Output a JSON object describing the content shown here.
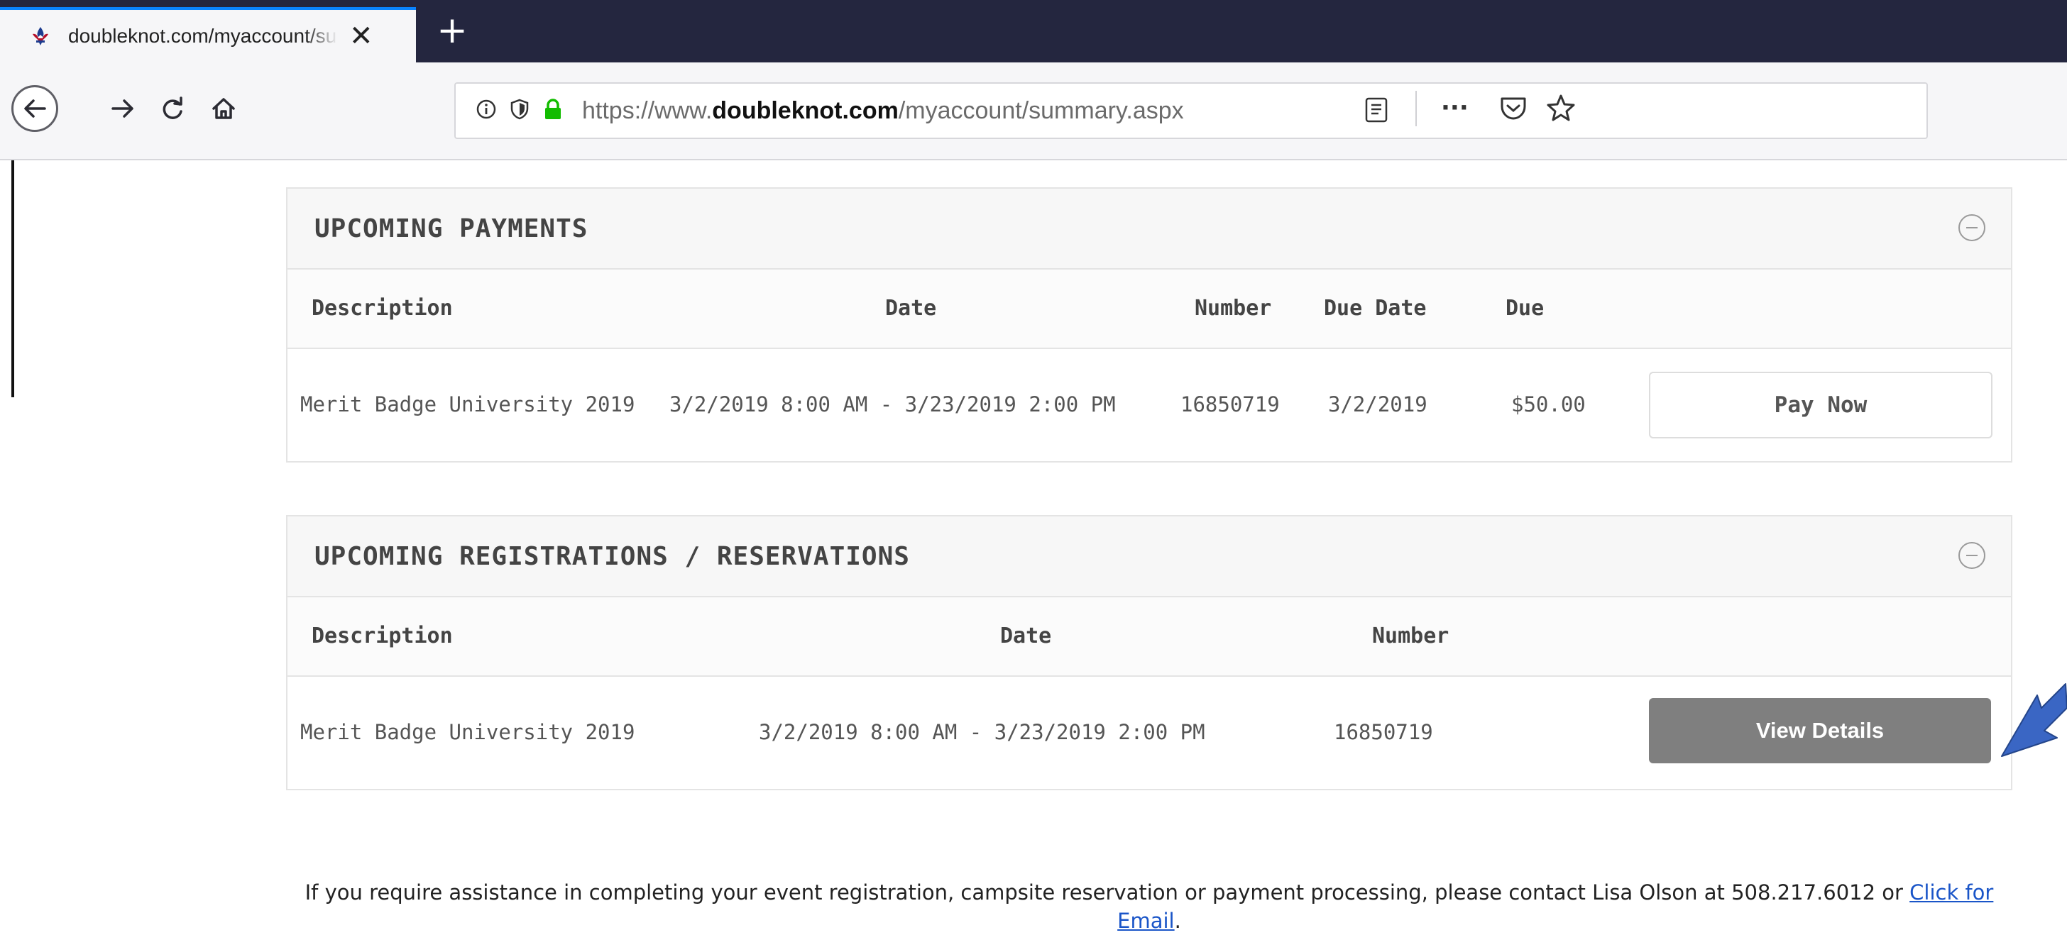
{
  "browser": {
    "tab_title": "doubleknot.com/myaccount/summary.aspx",
    "url_prefix": "https://www.",
    "url_host": "doubleknot.com",
    "url_path": "/myaccount/summary.aspx",
    "new_tab_symbol": "+",
    "close_symbol": "✕",
    "more_symbol": "···"
  },
  "payments": {
    "title": "UPCOMING PAYMENTS",
    "columns": [
      "Description",
      "Date",
      "Number",
      "Due Date",
      "Due"
    ],
    "rows": [
      {
        "description": "Merit Badge University 2019",
        "date": "3/2/2019 8:00 AM - 3/23/2019 2:00 PM",
        "number": "16850719",
        "due_date": "3/2/2019",
        "due": "$50.00"
      }
    ],
    "action_label": "Pay Now"
  },
  "registrations": {
    "title": "UPCOMING REGISTRATIONS / RESERVATIONS",
    "columns": [
      "Description",
      "Date",
      "Number"
    ],
    "rows": [
      {
        "description": "Merit Badge University 2019",
        "date": "3/2/2019 8:00 AM - 3/23/2019 2:00 PM",
        "number": "16850719"
      }
    ],
    "action_label": "View Details"
  },
  "footer": {
    "text": "If you require assistance in completing your event registration, campsite reservation or payment processing, please contact Lisa Olson at 508.217.6012 or",
    "link_text": "Click for Email",
    "suffix": "."
  },
  "colors": {
    "tabbar": "#24263f",
    "accent": "#0a84ff",
    "view_button": "#7f7f7f",
    "arrow": "#3a66c4",
    "link": "#1a55c8"
  }
}
